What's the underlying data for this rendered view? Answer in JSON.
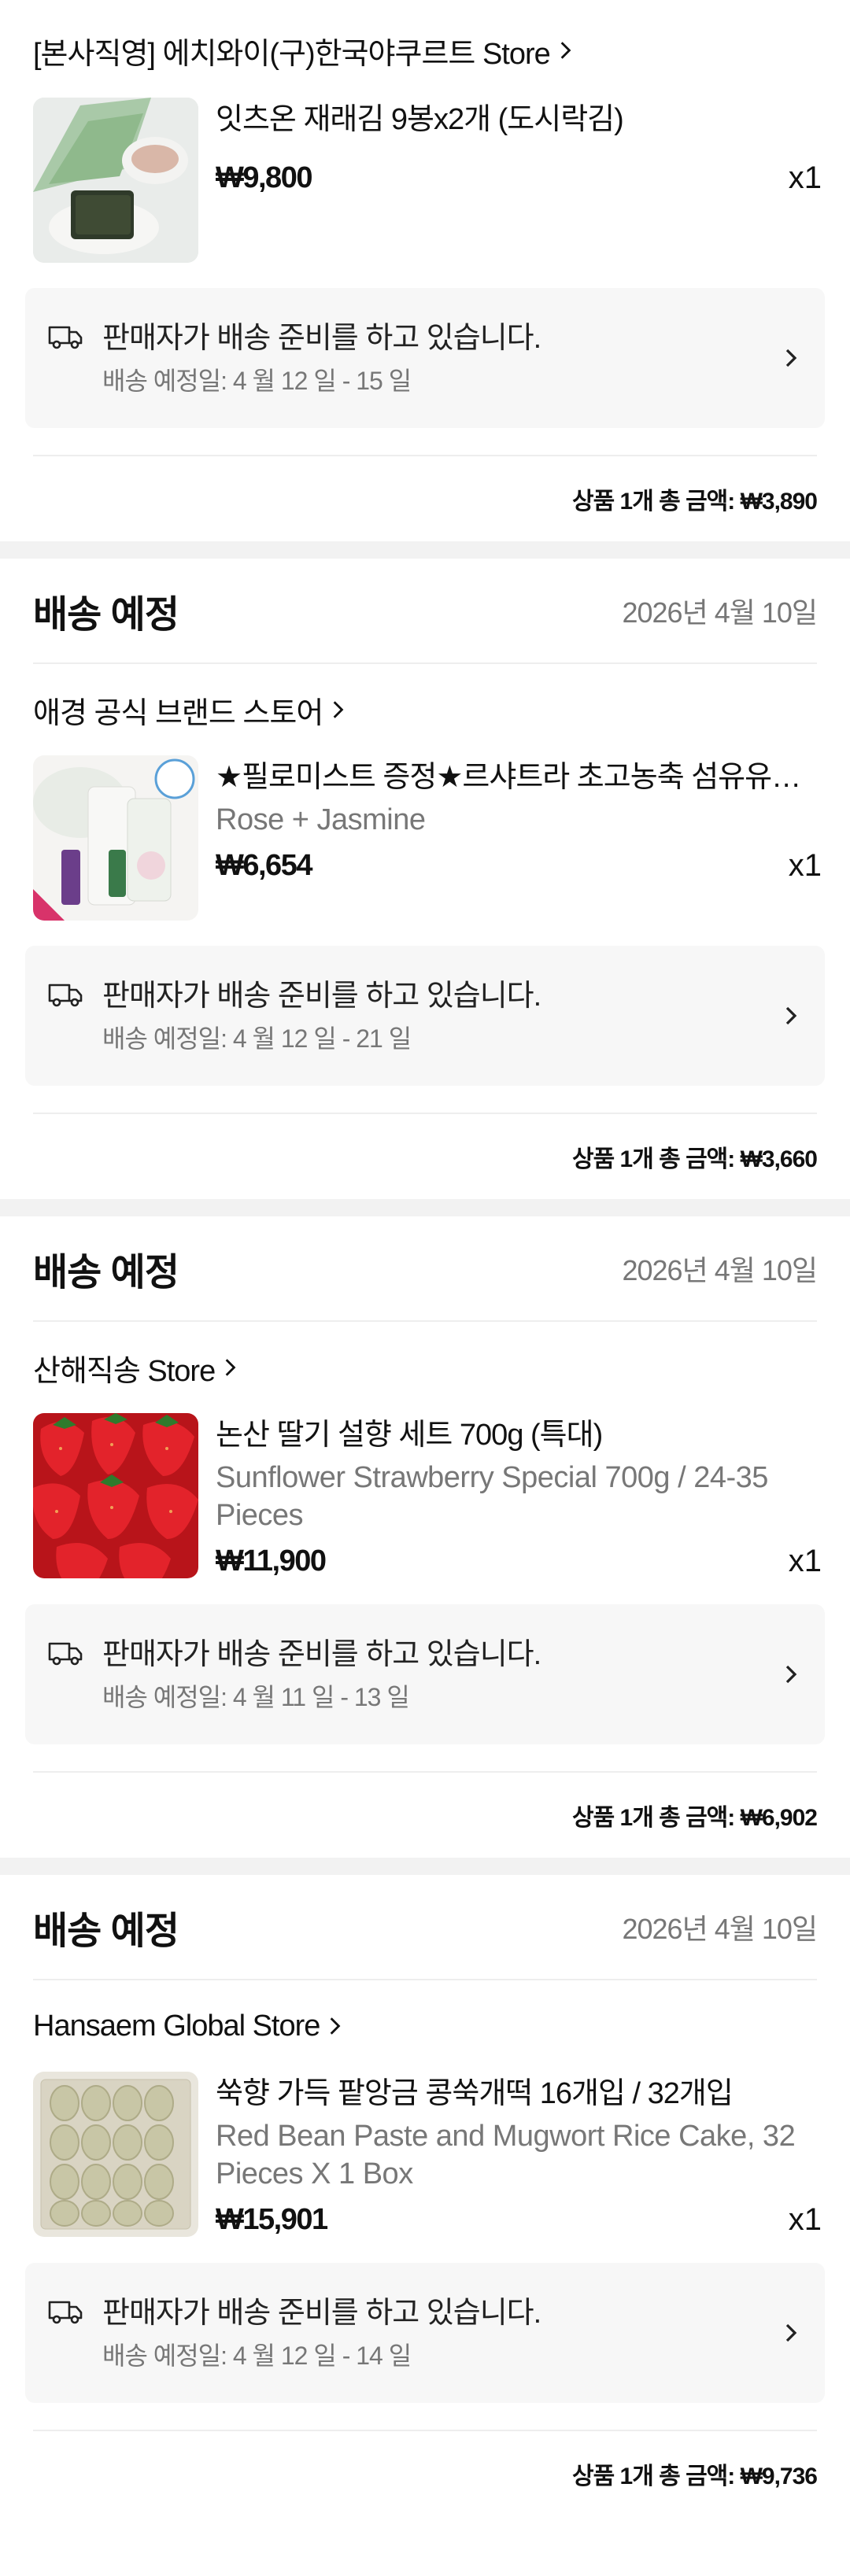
{
  "colors": {
    "background": "#ffffff",
    "divider": "#f2f2f2",
    "muted": "#777777",
    "shipping_box": "#f7f7f7"
  },
  "groups": [
    {
      "header": null,
      "store": "[본사직영] 에치와이(구)한국야쿠르트 Store",
      "product": {
        "name": "잇츠온 재래김 9봉x2개 (도시락김)",
        "variant": "",
        "price": "₩9,800",
        "qty": "x1",
        "image": "seaweed-photo"
      },
      "shipping": {
        "status": "판매자가 배송 준비를 하고 있습니다.",
        "eta": "배송 예정일: 4 월 12 일 - 15 일"
      },
      "total": "상품 1개 총 금액: ₩3,890"
    },
    {
      "header": {
        "title": "배송 예정",
        "date": "2026년 4월 10일"
      },
      "store": "애경 공식 브랜드 스토어",
      "product": {
        "name": "★필로미스트 증정★르샤트라 초고농축 섬유유연제",
        "variant": "Rose + Jasmine",
        "price": "₩6,654",
        "qty": "x1",
        "image": "softener-photo"
      },
      "shipping": {
        "status": "판매자가 배송 준비를 하고 있습니다.",
        "eta": "배송 예정일: 4 월 12 일 - 21 일"
      },
      "total": "상품 1개 총 금액: ₩3,660"
    },
    {
      "header": {
        "title": "배송 예정",
        "date": "2026년 4월 10일"
      },
      "store": "산해직송 Store",
      "product": {
        "name": "논산 딸기 설향 세트 700g (특대)",
        "variant": "Sunflower Strawberry Special 700g / 24-35 Pieces",
        "price": "₩11,900",
        "qty": "x1",
        "image": "strawberry-photo"
      },
      "shipping": {
        "status": "판매자가 배송 준비를 하고 있습니다.",
        "eta": "배송 예정일: 4 월 11 일 - 13 일"
      },
      "total": "상품 1개 총 금액: ₩6,902"
    },
    {
      "header": {
        "title": "배송 예정",
        "date": "2026년 4월 10일"
      },
      "store": "Hansaem Global Store",
      "product": {
        "name": "쑥향 가득 팥앙금 콩쑥개떡 16개입 / 32개입",
        "variant": "Red Bean Paste and Mugwort Rice Cake, 32 Pieces X 1 Box",
        "price": "₩15,901",
        "qty": "x1",
        "image": "rice-cake-photo"
      },
      "shipping": {
        "status": "판매자가 배송 준비를 하고 있습니다.",
        "eta": "배송 예정일: 4 월 12 일 - 14 일"
      },
      "total": "상품 1개 총 금액: ₩9,736"
    }
  ]
}
